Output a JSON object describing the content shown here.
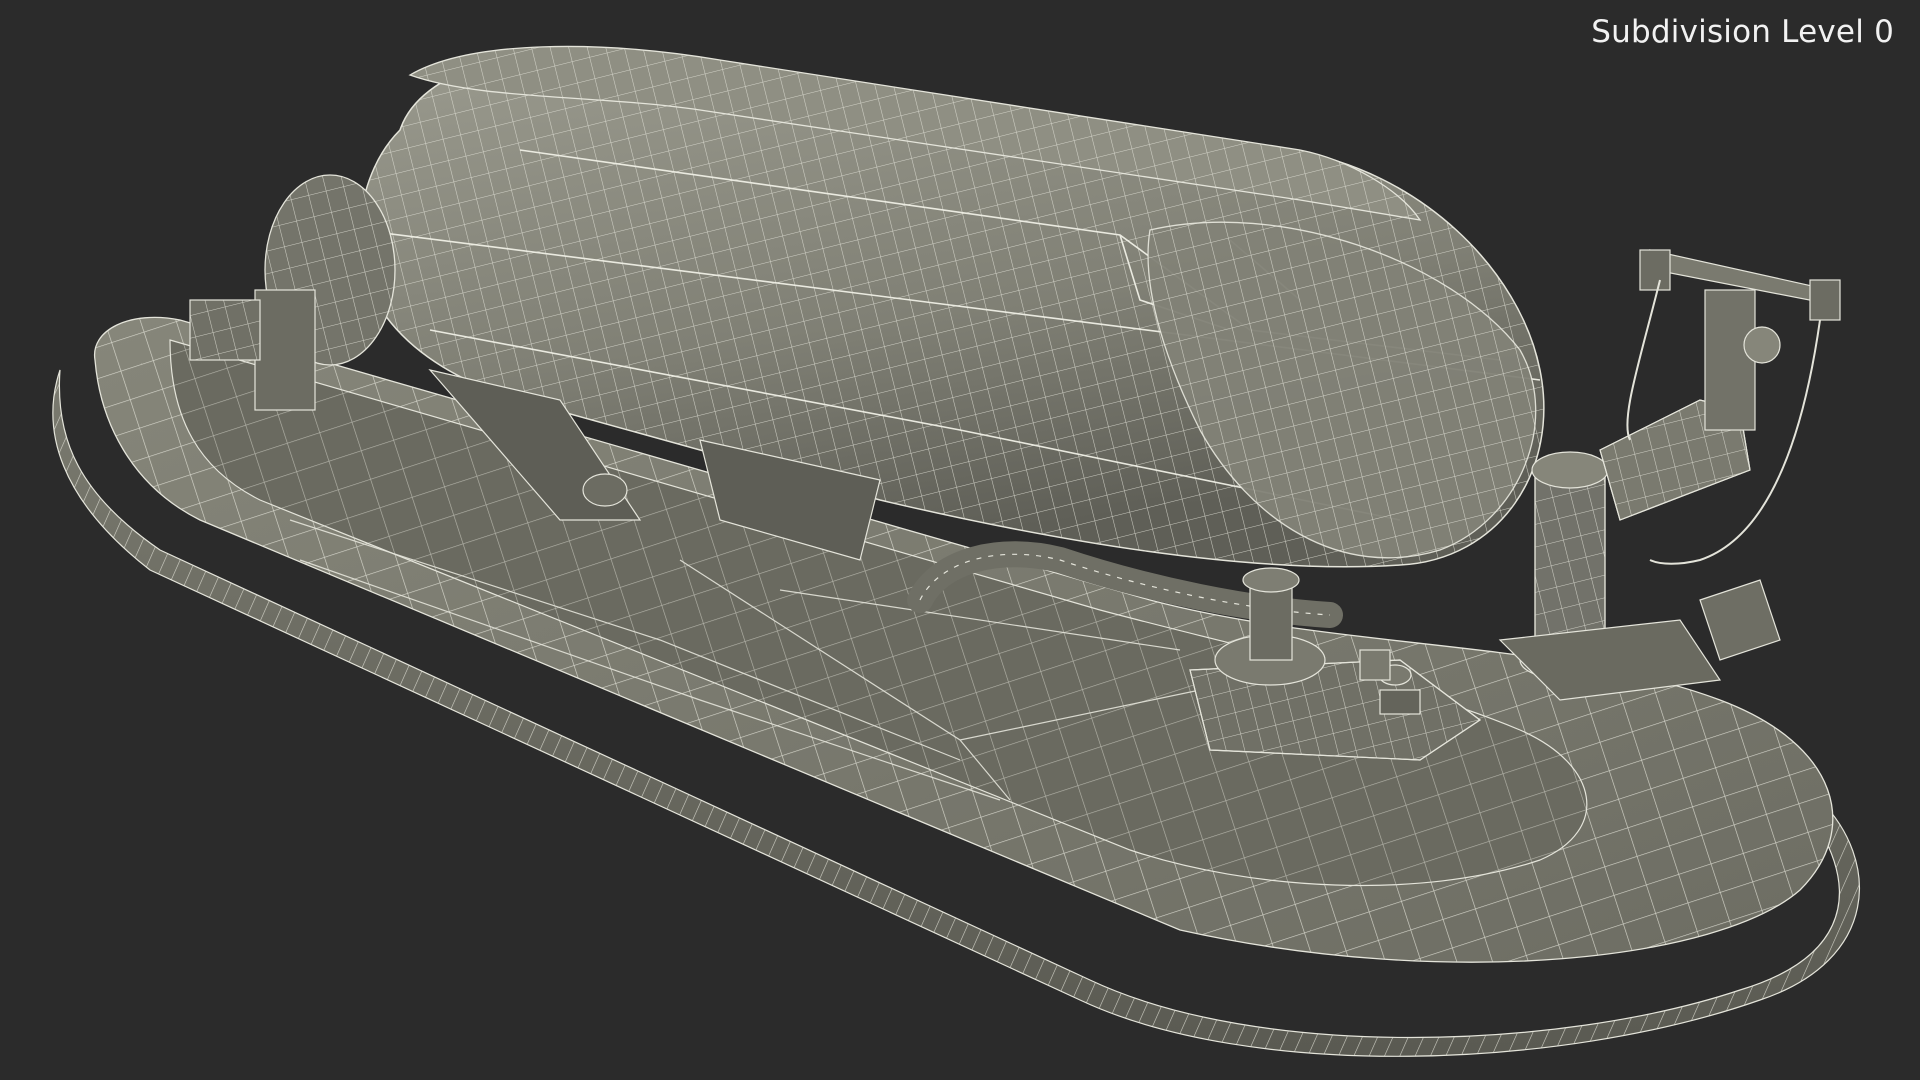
{
  "viewport": {
    "overlay_label": "Subdivision Level 0",
    "background_color": "#2b2b2b"
  },
  "model": {
    "description_icon": "wireframe-mesh-icon",
    "surface_color": "#77776c",
    "wire_color": "#e6e6dc",
    "shadow_color": "#4f4f48"
  }
}
